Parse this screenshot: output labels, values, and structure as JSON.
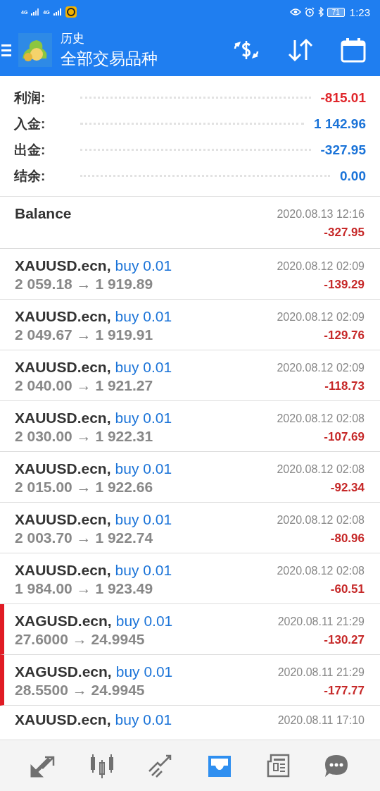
{
  "status_bar": {
    "network_1": "4G",
    "network_2": "4G",
    "battery": "71",
    "time": "1:23"
  },
  "header": {
    "title": "历史",
    "subtitle": "全部交易品种"
  },
  "summary": [
    {
      "label": "利润:",
      "value": "-815.01",
      "color": "#e0262b"
    },
    {
      "label": "入金:",
      "value": "1 142.96",
      "color": "#1a73d8"
    },
    {
      "label": "出金:",
      "value": "-327.95",
      "color": "#1a73d8"
    },
    {
      "label": "结余:",
      "value": "0.00",
      "color": "#1a73d8"
    }
  ],
  "entries": [
    {
      "kind": "balance",
      "title": "Balance",
      "time": "2020.08.13 12:16",
      "amount": "-327.95",
      "flagged": false
    },
    {
      "kind": "trade",
      "symbol": "XAUUSD.ecn,",
      "action": "buy 0.01",
      "prices": "2 059.18 → 1 919.89",
      "time": "2020.08.12 02:09",
      "amount": "-139.29",
      "flagged": false
    },
    {
      "kind": "trade",
      "symbol": "XAUUSD.ecn,",
      "action": "buy 0.01",
      "prices": "2 049.67 → 1 919.91",
      "time": "2020.08.12 02:09",
      "amount": "-129.76",
      "flagged": false
    },
    {
      "kind": "trade",
      "symbol": "XAUUSD.ecn,",
      "action": "buy 0.01",
      "prices": "2 040.00 → 1 921.27",
      "time": "2020.08.12 02:09",
      "amount": "-118.73",
      "flagged": false
    },
    {
      "kind": "trade",
      "symbol": "XAUUSD.ecn,",
      "action": "buy 0.01",
      "prices": "2 030.00 → 1 922.31",
      "time": "2020.08.12 02:08",
      "amount": "-107.69",
      "flagged": false
    },
    {
      "kind": "trade",
      "symbol": "XAUUSD.ecn,",
      "action": "buy 0.01",
      "prices": "2 015.00 → 1 922.66",
      "time": "2020.08.12 02:08",
      "amount": "-92.34",
      "flagged": false
    },
    {
      "kind": "trade",
      "symbol": "XAUUSD.ecn,",
      "action": "buy 0.01",
      "prices": "2 003.70 → 1 922.74",
      "time": "2020.08.12 02:08",
      "amount": "-80.96",
      "flagged": false
    },
    {
      "kind": "trade",
      "symbol": "XAUUSD.ecn,",
      "action": "buy 0.01",
      "prices": "1 984.00 → 1 923.49",
      "time": "2020.08.12 02:08",
      "amount": "-60.51",
      "flagged": false
    },
    {
      "kind": "trade",
      "symbol": "XAGUSD.ecn,",
      "action": "buy 0.01",
      "prices": "27.6000 → 24.9945",
      "time": "2020.08.11 21:29",
      "amount": "-130.27",
      "flagged": true
    },
    {
      "kind": "trade",
      "symbol": "XAGUSD.ecn,",
      "action": "buy 0.01",
      "prices": "28.5500 → 24.9945",
      "time": "2020.08.11 21:29",
      "amount": "-177.77",
      "flagged": true
    },
    {
      "kind": "partial",
      "symbol": "XAUUSD.ecn,",
      "action": "buy 0.01",
      "time": "2020.08.11 17:10",
      "flagged": false
    }
  ],
  "nav": [
    {
      "kind": "trade",
      "selected": false
    },
    {
      "kind": "quotes",
      "selected": false
    },
    {
      "kind": "chart",
      "selected": false
    },
    {
      "kind": "history",
      "selected": true
    },
    {
      "kind": "news",
      "selected": false
    },
    {
      "kind": "chat",
      "selected": false
    }
  ]
}
